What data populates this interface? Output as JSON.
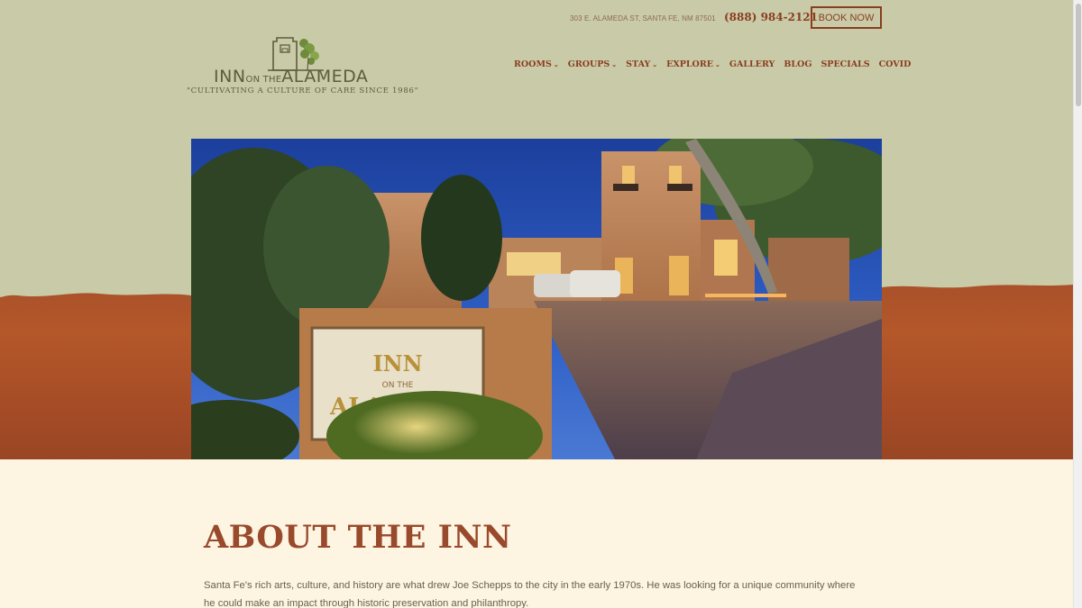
{
  "header": {
    "address": "303 E. ALAMEDA ST, SANTA FE, NM 87501",
    "phone": "(888) 984-2121",
    "book_label": "BOOK NOW"
  },
  "logo": {
    "name_inn": "INN",
    "name_on_the": "ON THE",
    "name_alameda": "ALAMEDA",
    "tagline": "\"CULTIVATING A CULTURE OF CARE SINCE 1986\""
  },
  "nav": {
    "items": [
      {
        "label": "ROOMS",
        "dropdown": true
      },
      {
        "label": "GROUPS",
        "dropdown": true
      },
      {
        "label": "STAY",
        "dropdown": true
      },
      {
        "label": "EXPLORE",
        "dropdown": true
      },
      {
        "label": "GALLERY",
        "dropdown": false
      },
      {
        "label": "BLOG",
        "dropdown": false
      },
      {
        "label": "SPECIALS",
        "dropdown": false
      },
      {
        "label": "COVID",
        "dropdown": false
      }
    ],
    "caret_icon": "chevron-down-icon"
  },
  "hero": {
    "sign_line1": "INN",
    "sign_line2": "ON THE",
    "sign_line3": "ALAMEDA"
  },
  "about": {
    "title": "ABOUT THE INN",
    "body": "Santa Fe's rich arts, culture, and history are what drew Joe Schepps to the city in the early 1970s. He was looking for a unique community where he could make an impact through historic preservation and philanthropy."
  },
  "colors": {
    "header_bg": "#c9cba8",
    "accent": "#8a3d20",
    "rust_band": "#a9502a",
    "page_bg": "#fdf4e1",
    "title": "#9a4a2c"
  }
}
